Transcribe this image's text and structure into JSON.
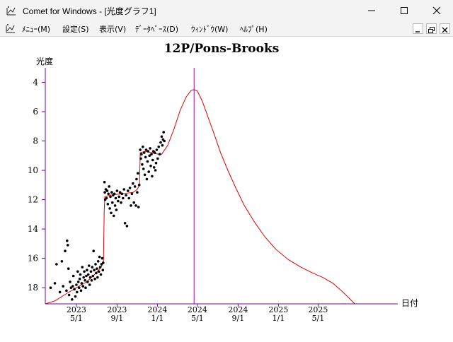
{
  "window": {
    "title": "Comet for Windows - [光度グラフ1]"
  },
  "menu": {
    "items": [
      {
        "label": "ﾒﾆｭｰ(M)"
      },
      {
        "label": "設定(S)"
      },
      {
        "label": "表示(V)"
      },
      {
        "label": "ﾃﾞｰﾀﾍﾞｰｽ(D)"
      },
      {
        "label": "ｳｨﾝﾄﾞｳ(W)"
      },
      {
        "label": "ﾍﾙﾌﾟ(H)"
      }
    ]
  },
  "chart_data": {
    "type": "scatter",
    "title": "12P/Pons-Brooks",
    "ylabel": "光度",
    "xlabel": "日付",
    "y_reversed": true,
    "ylim": [
      19.1,
      3.4
    ],
    "xlim": [
      "2023-01-27",
      "2025-12-28"
    ],
    "y_ticks": [
      4,
      6,
      8,
      10,
      12,
      14,
      16,
      18
    ],
    "x_ticks": [
      {
        "year": "2023",
        "md": "5/1",
        "date": "2023-05-01"
      },
      {
        "year": "2023",
        "md": "9/1",
        "date": "2023-09-01"
      },
      {
        "year": "2024",
        "md": "1/1",
        "date": "2024-01-01"
      },
      {
        "year": "2024",
        "md": "5/1",
        "date": "2024-05-01"
      },
      {
        "year": "2024",
        "md": "9/1",
        "date": "2024-09-01"
      },
      {
        "year": "2025",
        "md": "1/1",
        "date": "2025-01-01"
      },
      {
        "year": "2025",
        "md": "5/1",
        "date": "2025-05-01"
      }
    ],
    "perihelion_marker": "2024-04-21",
    "colors": {
      "axis": "#7000b0",
      "marker_line": "#b000c0",
      "curve": "#e00000",
      "points": "#000000"
    },
    "curve": [
      [
        "2023-01-27",
        19.1
      ],
      [
        "2023-02-25",
        18.9
      ],
      [
        "2023-04-01",
        18.4
      ],
      [
        "2023-05-01",
        18.0
      ],
      [
        "2023-06-01",
        17.6
      ],
      [
        "2023-06-25",
        17.1
      ],
      [
        "2023-07-15",
        16.6
      ],
      [
        "2023-07-22",
        16.2
      ],
      [
        "2023-07-24",
        12.8
      ],
      [
        "2023-07-26",
        11.8
      ],
      [
        "2023-08-10",
        11.7
      ],
      [
        "2023-09-15",
        11.6
      ],
      [
        "2023-10-20",
        11.5
      ],
      [
        "2023-11-01",
        11.3
      ],
      [
        "2023-11-08",
        11.0
      ],
      [
        "2023-11-10",
        8.8
      ],
      [
        "2023-11-25",
        8.7
      ],
      [
        "2023-12-15",
        8.8
      ],
      [
        "2024-01-04",
        8.9
      ],
      [
        "2024-01-14",
        8.9
      ],
      [
        "2024-02-01",
        8.3
      ],
      [
        "2024-02-20",
        7.2
      ],
      [
        "2024-03-10",
        5.9
      ],
      [
        "2024-03-28",
        5.0
      ],
      [
        "2024-04-12",
        4.55
      ],
      [
        "2024-04-21",
        4.5
      ],
      [
        "2024-05-01",
        4.6
      ],
      [
        "2024-05-16",
        5.3
      ],
      [
        "2024-06-01",
        6.3
      ],
      [
        "2024-06-20",
        7.5
      ],
      [
        "2024-07-10",
        8.8
      ],
      [
        "2024-08-01",
        10.0
      ],
      [
        "2024-08-25",
        11.2
      ],
      [
        "2024-09-20",
        12.4
      ],
      [
        "2024-10-20",
        13.5
      ],
      [
        "2024-11-20",
        14.5
      ],
      [
        "2024-12-25",
        15.4
      ],
      [
        "2025-02-01",
        16.1
      ],
      [
        "2025-03-10",
        16.6
      ],
      [
        "2025-04-15",
        17.0
      ],
      [
        "2025-05-15",
        17.3
      ],
      [
        "2025-06-15",
        17.7
      ],
      [
        "2025-07-15",
        18.3
      ],
      [
        "2025-08-20",
        19.1
      ]
    ],
    "points": [
      [
        "2023-02-12",
        18.0
      ],
      [
        "2023-02-25",
        17.7
      ],
      [
        "2023-03-02",
        16.4
      ],
      [
        "2023-03-12",
        18.3
      ],
      [
        "2023-03-18",
        16.2
      ],
      [
        "2023-03-22",
        17.9
      ],
      [
        "2023-03-28",
        15.5
      ],
      [
        "2023-04-01",
        18.2
      ],
      [
        "2023-04-03",
        14.8
      ],
      [
        "2023-04-05",
        15.1
      ],
      [
        "2023-04-07",
        16.7
      ],
      [
        "2023-04-09",
        18.5
      ],
      [
        "2023-04-12",
        17.6
      ],
      [
        "2023-04-15",
        18.0
      ],
      [
        "2023-04-18",
        18.8
      ],
      [
        "2023-04-20",
        17.9
      ],
      [
        "2023-04-22",
        17.2
      ],
      [
        "2023-04-25",
        18.1
      ],
      [
        "2023-04-28",
        18.6
      ],
      [
        "2023-05-01",
        17.8
      ],
      [
        "2023-05-03",
        18.3
      ],
      [
        "2023-05-05",
        16.9
      ],
      [
        "2023-05-07",
        17.6
      ],
      [
        "2023-05-09",
        18.0
      ],
      [
        "2023-05-11",
        17.4
      ],
      [
        "2023-05-13",
        17.1
      ],
      [
        "2023-05-15",
        18.2
      ],
      [
        "2023-05-17",
        17.7
      ],
      [
        "2023-05-19",
        16.6
      ],
      [
        "2023-05-21",
        17.9
      ],
      [
        "2023-05-23",
        17.3
      ],
      [
        "2023-05-25",
        16.9
      ],
      [
        "2023-05-27",
        17.5
      ],
      [
        "2023-05-29",
        18.0
      ],
      [
        "2023-05-31",
        17.2
      ],
      [
        "2023-06-02",
        16.8
      ],
      [
        "2023-06-04",
        17.6
      ],
      [
        "2023-06-06",
        17.1
      ],
      [
        "2023-06-08",
        16.5
      ],
      [
        "2023-06-10",
        17.8
      ],
      [
        "2023-06-12",
        17.3
      ],
      [
        "2023-06-14",
        16.9
      ],
      [
        "2023-06-16",
        17.5
      ],
      [
        "2023-06-18",
        16.6
      ],
      [
        "2023-06-20",
        17.2
      ],
      [
        "2023-06-22",
        15.5
      ],
      [
        "2023-06-24",
        16.8
      ],
      [
        "2023-06-26",
        17.4
      ],
      [
        "2023-06-28",
        16.4
      ],
      [
        "2023-06-30",
        17.0
      ],
      [
        "2023-07-02",
        16.7
      ],
      [
        "2023-07-04",
        17.3
      ],
      [
        "2023-07-06",
        16.2
      ],
      [
        "2023-07-08",
        16.9
      ],
      [
        "2023-07-10",
        15.9
      ],
      [
        "2023-07-12",
        16.6
      ],
      [
        "2023-07-14",
        17.1
      ],
      [
        "2023-07-16",
        16.4
      ],
      [
        "2023-07-18",
        16.0
      ],
      [
        "2023-07-20",
        16.8
      ],
      [
        "2023-07-21",
        16.3
      ],
      [
        "2023-07-25",
        10.8
      ],
      [
        "2023-07-26",
        11.5
      ],
      [
        "2023-07-27",
        12.0
      ],
      [
        "2023-07-29",
        11.3
      ],
      [
        "2023-07-31",
        11.9
      ],
      [
        "2023-08-02",
        11.4
      ],
      [
        "2023-08-04",
        12.3
      ],
      [
        "2023-08-06",
        11.6
      ],
      [
        "2023-08-08",
        11.1
      ],
      [
        "2023-08-10",
        12.6
      ],
      [
        "2023-08-12",
        11.8
      ],
      [
        "2023-08-14",
        12.9
      ],
      [
        "2023-08-16",
        11.5
      ],
      [
        "2023-08-18",
        12.2
      ],
      [
        "2023-08-20",
        11.7
      ],
      [
        "2023-08-22",
        13.1
      ],
      [
        "2023-08-24",
        11.6
      ],
      [
        "2023-08-26",
        12.4
      ],
      [
        "2023-08-28",
        11.9
      ],
      [
        "2023-08-30",
        12.7
      ],
      [
        "2023-09-01",
        11.4
      ],
      [
        "2023-09-04",
        12.1
      ],
      [
        "2023-09-07",
        11.8
      ],
      [
        "2023-09-10",
        11.5
      ],
      [
        "2023-09-13",
        12.2
      ],
      [
        "2023-09-16",
        11.6
      ],
      [
        "2023-09-19",
        11.9
      ],
      [
        "2023-09-22",
        11.3
      ],
      [
        "2023-09-25",
        13.6
      ],
      [
        "2023-09-28",
        11.7
      ],
      [
        "2023-10-01",
        13.8
      ],
      [
        "2023-10-04",
        11.4
      ],
      [
        "2023-10-07",
        11.9
      ],
      [
        "2023-10-10",
        11.2
      ],
      [
        "2023-10-13",
        12.4
      ],
      [
        "2023-10-16",
        11.6
      ],
      [
        "2023-10-19",
        10.9
      ],
      [
        "2023-10-22",
        12.2
      ],
      [
        "2023-10-25",
        11.1
      ],
      [
        "2023-10-28",
        12.4
      ],
      [
        "2023-10-30",
        10.6
      ],
      [
        "2023-11-01",
        11.5
      ],
      [
        "2023-11-03",
        10.2
      ],
      [
        "2023-11-05",
        12.5
      ],
      [
        "2023-11-07",
        11.0
      ],
      [
        "2023-11-10",
        8.6
      ],
      [
        "2023-11-12",
        9.2
      ],
      [
        "2023-11-14",
        8.9
      ],
      [
        "2023-11-16",
        9.6
      ],
      [
        "2023-11-18",
        8.4
      ],
      [
        "2023-11-20",
        9.9
      ],
      [
        "2023-11-22",
        8.8
      ],
      [
        "2023-11-24",
        10.3
      ],
      [
        "2023-11-26",
        9.1
      ],
      [
        "2023-11-28",
        8.6
      ],
      [
        "2023-11-30",
        10.6
      ],
      [
        "2023-12-02",
        9.4
      ],
      [
        "2023-12-04",
        8.7
      ],
      [
        "2023-12-06",
        10.1
      ],
      [
        "2023-12-08",
        9.0
      ],
      [
        "2023-12-10",
        8.5
      ],
      [
        "2023-12-12",
        9.7
      ],
      [
        "2023-12-14",
        8.9
      ],
      [
        "2023-12-16",
        10.4
      ],
      [
        "2023-12-18",
        9.3
      ],
      [
        "2023-12-20",
        8.7
      ],
      [
        "2023-12-22",
        9.8
      ],
      [
        "2023-12-24",
        8.8
      ],
      [
        "2023-12-26",
        10.0
      ],
      [
        "2023-12-28",
        9.5
      ],
      [
        "2023-12-30",
        8.6
      ],
      [
        "2024-01-02",
        9.2
      ],
      [
        "2024-01-05",
        8.4
      ],
      [
        "2024-01-08",
        8.9
      ],
      [
        "2024-01-11",
        8.1
      ],
      [
        "2024-01-14",
        7.7
      ],
      [
        "2024-01-16",
        8.3
      ],
      [
        "2024-01-18",
        7.9
      ],
      [
        "2024-01-20",
        7.4
      ],
      [
        "2024-01-22",
        8.0
      ]
    ]
  }
}
